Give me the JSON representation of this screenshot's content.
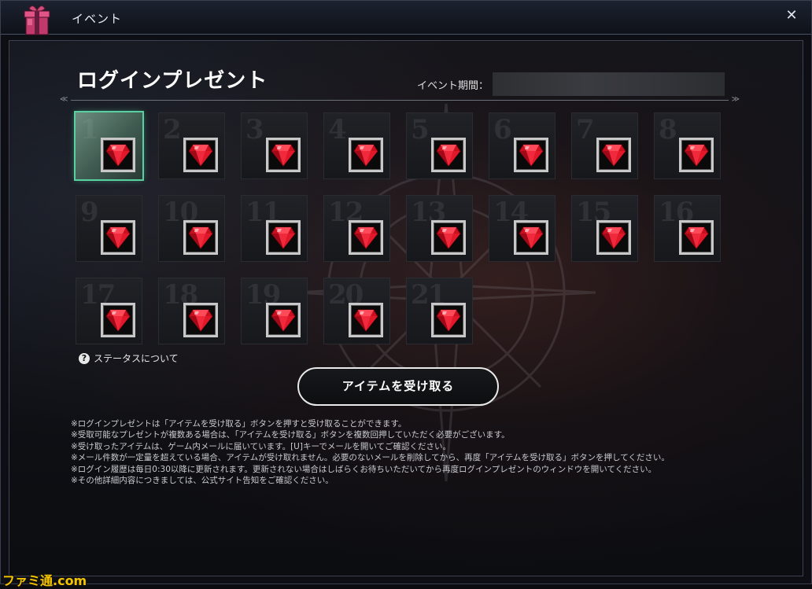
{
  "window": {
    "title": "イベント",
    "close_label": "✕"
  },
  "header": {
    "page_title": "ログインプレゼント",
    "period_label": "イベント期間："
  },
  "grid": {
    "days": [
      "1",
      "2",
      "3",
      "4",
      "5",
      "6",
      "7",
      "8",
      "9",
      "10",
      "11",
      "12",
      "13",
      "14",
      "15",
      "16",
      "17",
      "18",
      "19",
      "20",
      "21"
    ],
    "active_day": 1,
    "item_icon": "red-gem-icon"
  },
  "status_help": {
    "icon_label": "?",
    "label": "ステータスについて"
  },
  "actions": {
    "receive_label": "アイテムを受け取る"
  },
  "notes": [
    "※ログインプレゼントは「アイテムを受け取る」ボタンを押すと受け取ることができます。",
    "※受取可能なプレゼントが複数ある場合は、「アイテムを受け取る」ボタンを複数回押していただく必要がございます。",
    "※受け取ったアイテムは、ゲーム内メールに届いています。[U]キーでメールを開いてご確認ください。",
    "※メール件数が一定量を超えている場合、アイテムが受け取れません。必要のないメールを削除してから、再度「アイテムを受け取る」ボタンを押してください。",
    "※ログイン履歴は毎日0:30以降に更新されます。更新されない場合はしばらくお待ちいただいてから再度ログインプレゼントのウィンドウを開いてください。",
    "※その他詳細内容につきましては、公式サイト告知をご確認ください。"
  ],
  "watermark": "ファミ通.com",
  "colors": {
    "active_border": "#58d0a0",
    "gem_red": "#e0182a"
  }
}
